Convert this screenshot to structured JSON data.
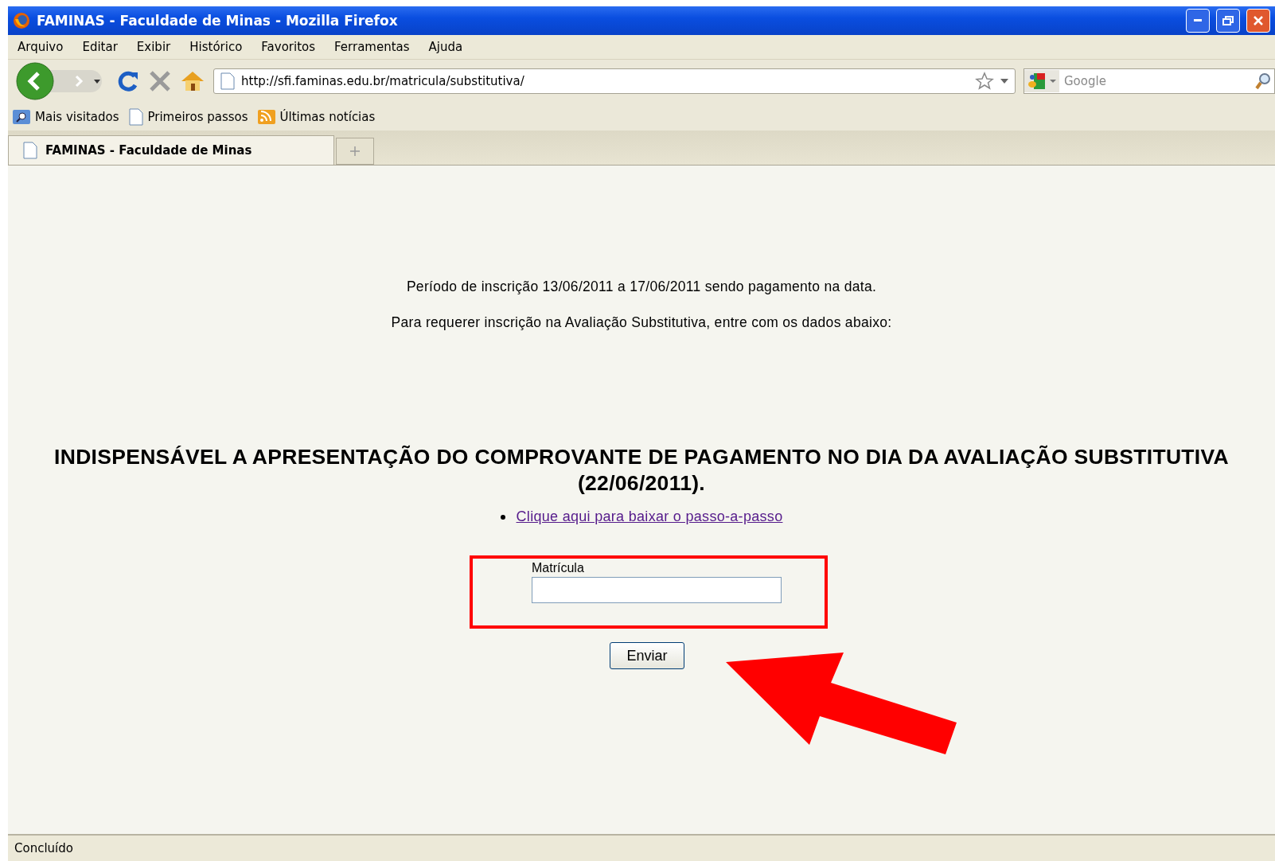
{
  "window": {
    "title": "FAMINAS - Faculdade de Minas - Mozilla Firefox"
  },
  "menu": [
    "Arquivo",
    "Editar",
    "Exibir",
    "Histórico",
    "Favoritos",
    "Ferramentas",
    "Ajuda"
  ],
  "address_bar": {
    "value": "http://sfi.faminas.edu.br/matricula/substitutiva/"
  },
  "search": {
    "placeholder": "Google"
  },
  "bookmarks": [
    "Mais visitados",
    "Primeiros passos",
    "Últimas notícias"
  ],
  "tabs": [
    {
      "label": "FAMINAS - Faculdade de Minas",
      "selected": true
    }
  ],
  "page": {
    "lines": [
      "Período de inscrição 13/06/2011 a 17/06/2011 sendo pagamento na data.",
      "Para requerer inscrição na Avaliação Substitutiva, entre com os dados abaixo:"
    ],
    "notice": [
      "INDISPENSÁVEL A APRESENTAÇÃO DO COMPROVANTE DE PAGAMENTO NO DIA DA AVALIAÇÃO SUBSTITUTIVA",
      "(22/06/2011)."
    ],
    "link": "Clique aqui para baixar o passo-a-passo",
    "field": {
      "label": "Matrícula"
    },
    "button": "Enviar"
  },
  "status_bar": "Concluído"
}
